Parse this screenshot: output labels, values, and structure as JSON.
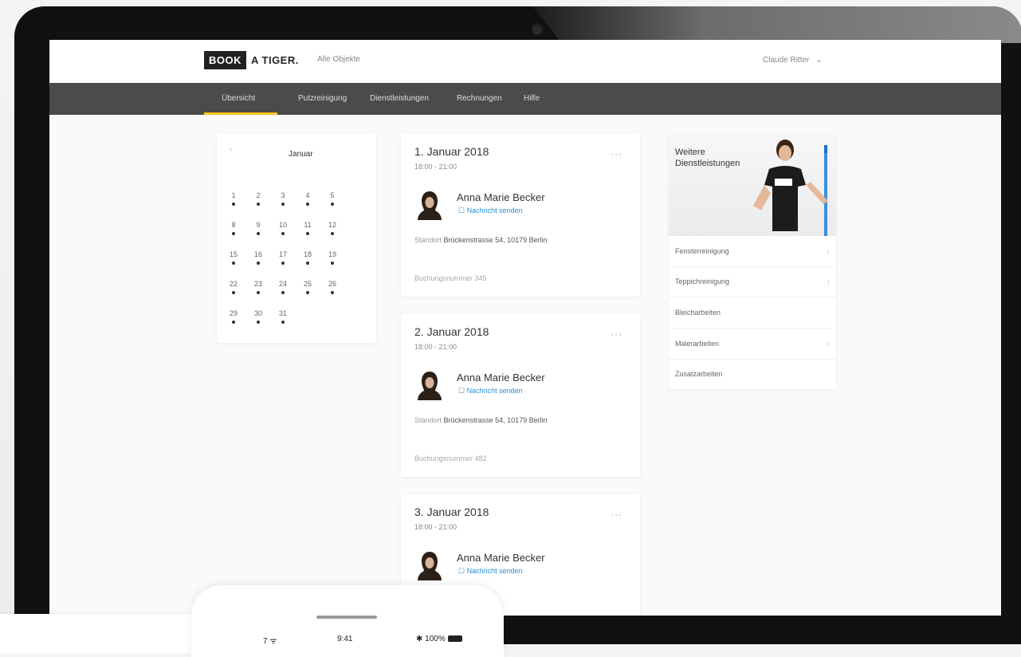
{
  "header": {
    "logo_box": "BOOK",
    "logo_text": "A TIGER.",
    "objects_label": "Alle Objekte",
    "user_name": "Claude Ritter",
    "user_chevron": "⌄"
  },
  "nav": {
    "items": [
      {
        "label": "Übersicht",
        "active": true
      },
      {
        "label": "Putzreinigung",
        "active": false
      },
      {
        "label": "Dienstleistungen",
        "active": false
      },
      {
        "label": "Rechnungen",
        "active": false
      },
      {
        "label": "Hilfe",
        "active": false
      }
    ],
    "active_color": "#f5c518"
  },
  "calendar": {
    "prev_arrow": "‹",
    "month": "Januar",
    "days": [
      "1",
      "2",
      "3",
      "4",
      "5",
      "8",
      "9",
      "10",
      "11",
      "12",
      "15",
      "16",
      "17",
      "18",
      "19",
      "22",
      "23",
      "24",
      "25",
      "26",
      "29",
      "30",
      "31"
    ]
  },
  "appointments": [
    {
      "date": "1. Januar 2018",
      "time": "18:00 - 21:00",
      "name": "Anna Marie Becker",
      "message": "Nachricht senden",
      "address_label": "Standort",
      "address": "Brückenstrasse 54, 10179 Berlin",
      "booking": "Buchungsnummer 345"
    },
    {
      "date": "2. Januar 2018",
      "time": "18:00 - 21:00",
      "name": "Anna Marie Becker",
      "message": "Nachricht senden",
      "address_label": "Standort",
      "address": "Brückenstrasse 54, 10179 Berlin",
      "booking": "Buchungsnummer 482"
    },
    {
      "date": "3. Januar 2018",
      "time": "18:00 - 21:00",
      "name": "Anna Marie Becker",
      "message": "Nachricht senden"
    }
  ],
  "appt_more": "···",
  "services": {
    "title_line1": "Weitere",
    "title_line2": "Dienstleistungen",
    "items": [
      "Fensterreinigung",
      "Teppichreinigung",
      "Bleicharbeiten",
      "Malerarbeiten",
      "Zusatzarbeiten"
    ],
    "chevron": "›"
  },
  "phone": {
    "carrier": "7",
    "time": "9:41",
    "battery": "100%"
  },
  "colors": {
    "accent": "#f5c518",
    "link": "#2a8fd6",
    "navbar": "#4b4b4b"
  }
}
